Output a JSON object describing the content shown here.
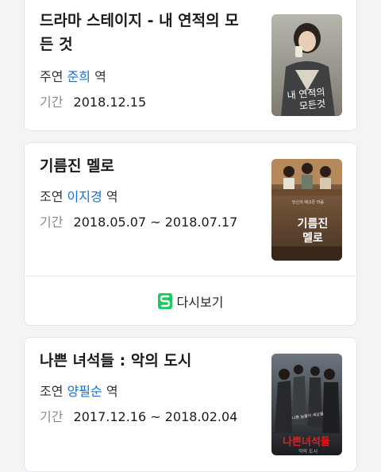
{
  "items": [
    {
      "title_line1": "드라마 스테이지 - 내 연적의 모",
      "title_line2": "든 것",
      "role_type": "주연",
      "actor": "준희",
      "role_suffix": "역",
      "period_label": "기간",
      "period": "2018.12.15",
      "poster_text": "내 연적의 모든것"
    },
    {
      "title_line1": "기름진 멜로",
      "role_type": "조연",
      "actor": "이지경",
      "role_suffix": "역",
      "period_label": "기간",
      "period": "2018.05.07 ~ 2018.07.17",
      "poster_text": "기름진 멜로",
      "rewatch_label": "다시보기"
    },
    {
      "title_line1": "나쁜 녀석들 : 악의 도시",
      "role_type": "조연",
      "actor": "양필순",
      "role_suffix": "역",
      "period_label": "기간",
      "period": "2017.12.16 ~ 2018.02.04",
      "poster_text": "나쁜녀석들"
    }
  ],
  "colors": {
    "accent": "#1a6fd1",
    "rewatch_icon": "#1ec95f"
  }
}
